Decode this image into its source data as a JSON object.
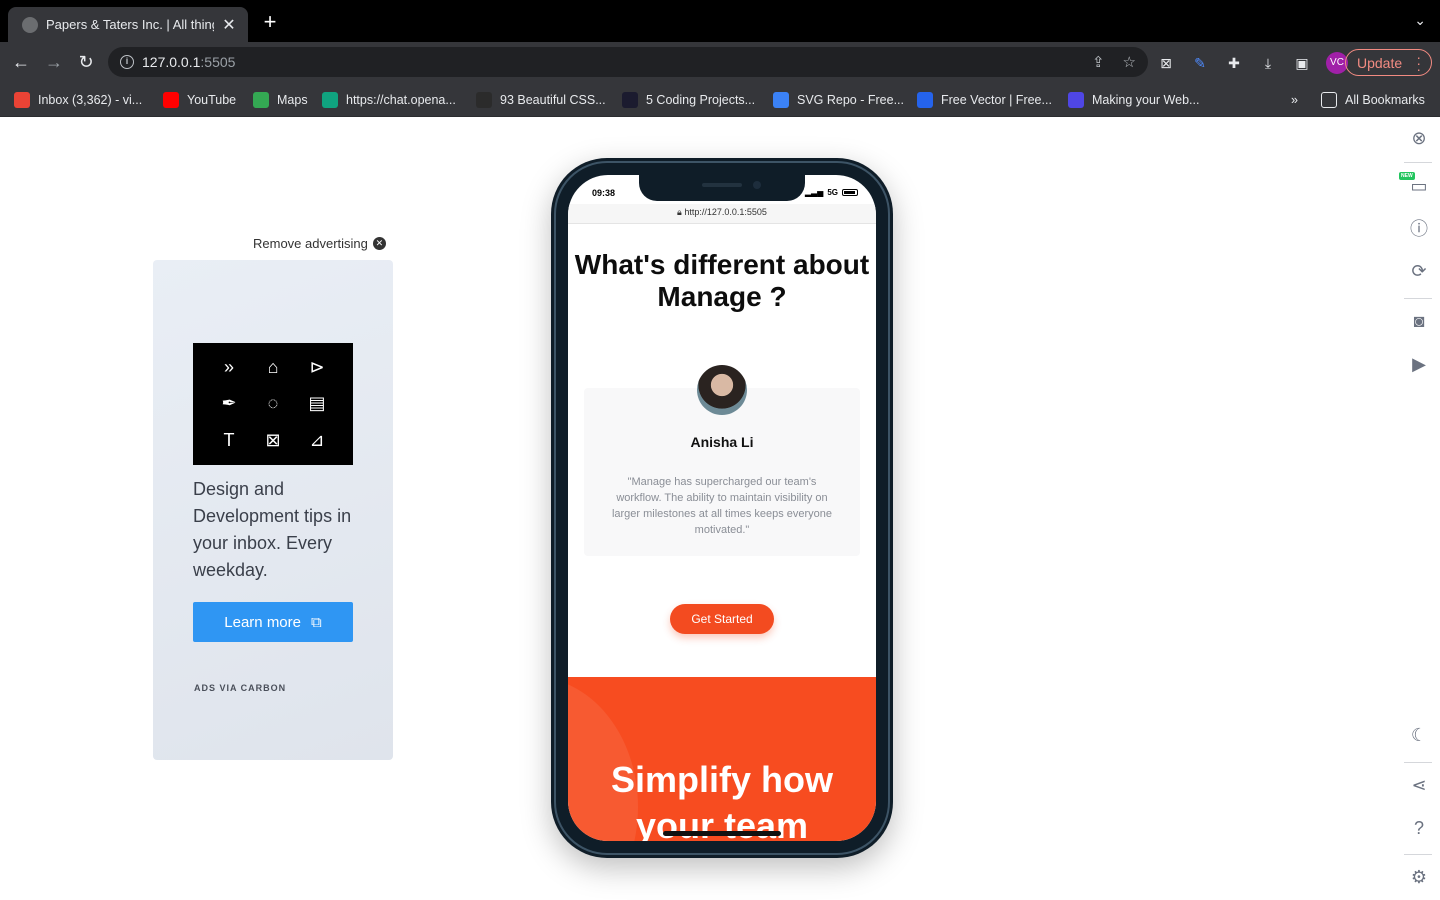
{
  "browser": {
    "tab_title": "Papers & Taters Inc. | All things",
    "tab_close": "✕",
    "new_tab": "+",
    "url_host": "127.0.0.1",
    "url_port": ":5505",
    "update_label": "Update",
    "profile_initials": "VC",
    "bookmarks": [
      {
        "label": "Inbox (3,362) - vi...",
        "color": "#ea4335"
      },
      {
        "label": "YouTube",
        "color": "#ff0000"
      },
      {
        "label": "Maps",
        "color": "#34a853"
      },
      {
        "label": "https://chat.opena...",
        "color": "#10a37f"
      },
      {
        "label": "93 Beautiful CSS...",
        "color": "#2b2b2b"
      },
      {
        "label": "5 Coding Projects...",
        "color": "#1b1b2f"
      },
      {
        "label": "SVG Repo - Free...",
        "color": "#3b82f6"
      },
      {
        "label": "Free Vector | Free...",
        "color": "#2563eb"
      },
      {
        "label": "Making your Web...",
        "color": "#4f46e5"
      }
    ],
    "bookmarks_overflow": "»",
    "all_bookmarks": "All Bookmarks"
  },
  "ad": {
    "remove_label": "Remove advertising",
    "text": "Design and Development tips in your inbox. Every weekday.",
    "button_label": "Learn more",
    "via_label": "ADS VIA CARBON"
  },
  "phone": {
    "time": "09:38",
    "network": "5G",
    "url": "http://127.0.0.1:5505",
    "heading": "What's different about Manage ?",
    "testimonial_name": "Anisha Li",
    "testimonial_quote": "\"Manage has supercharged our team's workflow. The ability to maintain visibility on larger milestones at all times keeps everyone motivated.\"",
    "cta_label": "Get Started",
    "promo_title": "Simplify how your team"
  },
  "sidebar": {
    "new_badge": "NEW"
  },
  "colors": {
    "accent": "#f34b20",
    "ad_button": "#2f96f3",
    "update": "#f28b82"
  }
}
